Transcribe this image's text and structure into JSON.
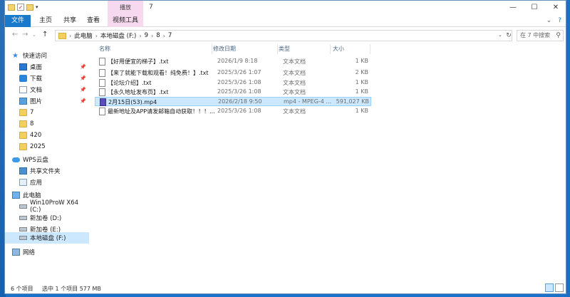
{
  "window": {
    "title": "7",
    "context_tab": "播放",
    "minimize": "—",
    "maximize": "☐",
    "close": "✕"
  },
  "ribbon": {
    "tabs": [
      "文件",
      "主页",
      "共享",
      "查看",
      "视频工具"
    ],
    "collapse_glyph": "⌄",
    "help_glyph": "?"
  },
  "address": {
    "crumbs": [
      "此电脑",
      "本地磁盘 (F:)",
      "9",
      "8",
      "7"
    ],
    "search_placeholder": "在 7 中搜索"
  },
  "nav": {
    "items": [
      {
        "label": "快速访问",
        "icon": "star-icon",
        "pin": false
      },
      {
        "label": "桌面",
        "icon": "desktop-icon",
        "pin": true
      },
      {
        "label": "下载",
        "icon": "download-icon",
        "pin": true
      },
      {
        "label": "文档",
        "icon": "document-icon",
        "pin": true
      },
      {
        "label": "图片",
        "icon": "picture-icon",
        "pin": true
      },
      {
        "label": "7",
        "icon": "folder-icon",
        "pin": false
      },
      {
        "label": "8",
        "icon": "folder-icon",
        "pin": false
      },
      {
        "label": "420",
        "icon": "folder-icon",
        "pin": false
      },
      {
        "label": "2025",
        "icon": "folder-icon",
        "pin": false
      },
      {
        "label": "WPS云盘",
        "icon": "cloud-icon",
        "pin": false
      },
      {
        "label": "共享文件夹",
        "icon": "share-folder-icon",
        "pin": false
      },
      {
        "label": "应用",
        "icon": "app-icon",
        "pin": false
      },
      {
        "label": "此电脑",
        "icon": "computer-icon",
        "pin": false
      },
      {
        "label": "Win10ProW X64 (C:)",
        "icon": "drive-icon",
        "pin": false
      },
      {
        "label": "新加卷 (D:)",
        "icon": "drive-icon",
        "pin": false
      },
      {
        "label": "新加卷 (E:)",
        "icon": "drive-icon",
        "pin": false
      },
      {
        "label": "本地磁盘 (F:)",
        "icon": "drive-icon",
        "pin": false
      },
      {
        "label": "网络",
        "icon": "network-icon",
        "pin": false
      }
    ]
  },
  "columns": {
    "name": "名称",
    "date": "修改日期",
    "type": "类型",
    "size": "大小"
  },
  "files": [
    {
      "name": "【好用便宜的梯子】.txt",
      "date": "2026/1/9 8:18",
      "type": "文本文档",
      "size": "1 KB",
      "selected": false,
      "kind": "txt"
    },
    {
      "name": "【来了就能下载和观看！纯免费！】.txt",
      "date": "2025/3/26 1:07",
      "type": "文本文档",
      "size": "2 KB",
      "selected": false,
      "kind": "txt"
    },
    {
      "name": "【论坛介绍】.txt",
      "date": "2025/3/26 1:08",
      "type": "文本文档",
      "size": "1 KB",
      "selected": false,
      "kind": "txt"
    },
    {
      "name": "【永久地址发布页】.txt",
      "date": "2025/3/26 1:08",
      "type": "文本文档",
      "size": "1 KB",
      "selected": false,
      "kind": "txt"
    },
    {
      "name": "2月15日(53).mp4",
      "date": "2026/2/18 9:50",
      "type": "mp4 - MPEG-4 ...",
      "size": "591,027 KB",
      "selected": true,
      "kind": "mp4"
    },
    {
      "name": "最新地址及APP请发邮箱自动获取！！！...",
      "date": "2025/3/26 1:08",
      "type": "文本文档",
      "size": "1 KB",
      "selected": false,
      "kind": "txt"
    }
  ],
  "status": {
    "count": "6 个项目",
    "selected": "选中 1 个项目  577 MB"
  }
}
